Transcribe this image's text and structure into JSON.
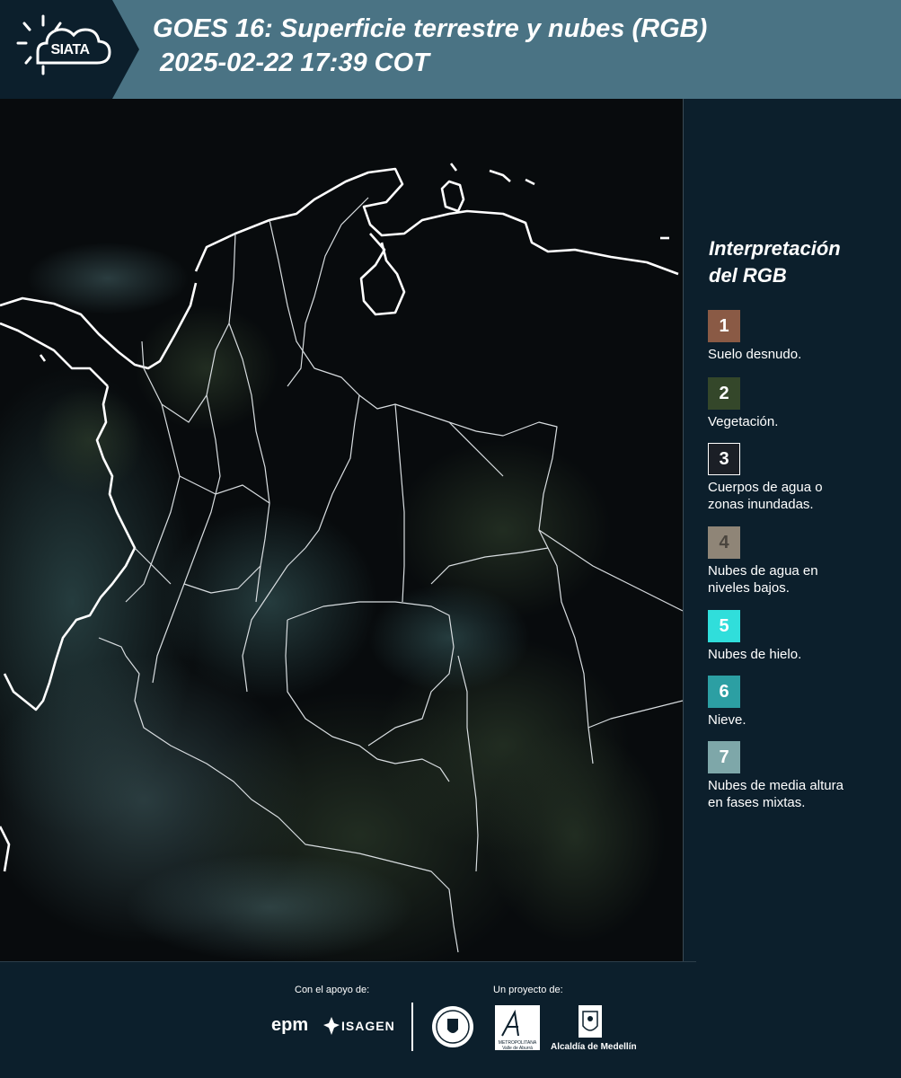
{
  "header": {
    "logo_text": "SIATA",
    "title": "GOES 16: Superficie terrestre y nubes (RGB)",
    "timestamp": "2025-02-22 17:39 COT",
    "background_color": "#4a7384",
    "logo_background_color": "#0c1f2c"
  },
  "legend": {
    "title_line1": "Interpretación",
    "title_line2": "del RGB",
    "items": [
      {
        "number": "1",
        "label_line1": "Suelo desnudo.",
        "label_line2": "",
        "color": "#8a5a45"
      },
      {
        "number": "2",
        "label_line1": "Vegetación.",
        "label_line2": "",
        "color": "#34472a"
      },
      {
        "number": "3",
        "label_line1": "Cuerpos de agua o",
        "label_line2": "zonas inundadas.",
        "color": "#1b1f26"
      },
      {
        "number": "4",
        "label_line1": "Nubes de agua en",
        "label_line2": "niveles bajos.",
        "color": "#8f8577"
      },
      {
        "number": "5",
        "label_line1": "Nubes de hielo.",
        "label_line2": "",
        "color": "#30dedb"
      },
      {
        "number": "6",
        "label_line1": "Nieve.",
        "label_line2": "",
        "color": "#2c9fa3"
      },
      {
        "number": "7",
        "label_line1": "Nubes de media altura",
        "label_line2": "en fases mixtas.",
        "color": "#7ea7a9"
      }
    ]
  },
  "footer": {
    "support_label": "Con el apoyo de:",
    "project_label": "Un proyecto de:",
    "epm": "epm",
    "isagen": "ISAGEN",
    "area_metropolitana": "Área",
    "area_subtitle": "METROPOLITANA Valle de Aburrá",
    "alcaldia": "Alcaldía de Medellín"
  }
}
